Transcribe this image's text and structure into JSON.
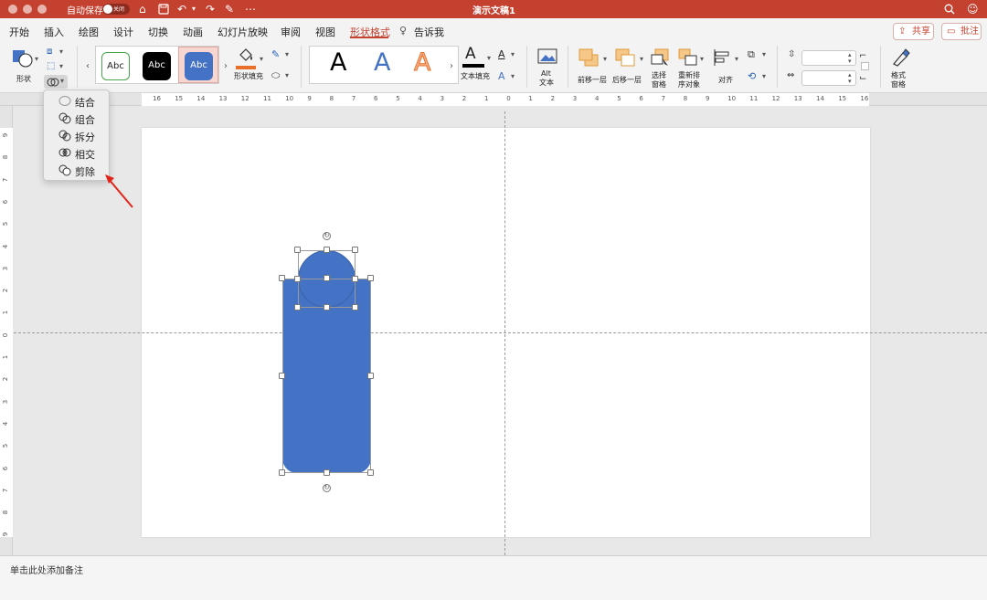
{
  "titlebar": {
    "autosave_label": "自动保存",
    "autosave_state": "关闭",
    "title": "演示文稿1",
    "icons": [
      "home-icon",
      "save-icon",
      "undo-icon",
      "redo-icon",
      "edit-icon",
      "more-icon",
      "search-icon",
      "account-icon"
    ]
  },
  "tabs": [
    "开始",
    "插入",
    "绘图",
    "设计",
    "切换",
    "动画",
    "幻灯片放映",
    "审阅",
    "视图",
    "形状格式",
    "告诉我"
  ],
  "active_tab": "形状格式",
  "share_label": "共享",
  "comment_label": "批注",
  "ribbon": {
    "shapes_label": "形状",
    "style_thumbs": [
      "Abc",
      "Abc",
      "Abc"
    ],
    "shape_fill_label": "形状填充",
    "wordart_letters": [
      "A",
      "A",
      "A"
    ],
    "text_fill_label": "文本填充",
    "alt_text_label_1": "Alt",
    "alt_text_label_2": "文本",
    "bring_forward": "前移一层",
    "send_backward": "后移一层",
    "selection_pane_1": "选择",
    "selection_pane_2": "窗格",
    "reorder_1": "重新排",
    "reorder_2": "序对象",
    "align": "对齐",
    "format_pane_1": "格式",
    "format_pane_2": "窗格"
  },
  "merge_menu": [
    {
      "label": "结合",
      "enabled": false
    },
    {
      "label": "组合",
      "enabled": true
    },
    {
      "label": "拆分",
      "enabled": true
    },
    {
      "label": "相交",
      "enabled": true
    },
    {
      "label": "剪除",
      "enabled": true
    }
  ],
  "ruler_h_labels": [
    "16",
    "15",
    "14",
    "13",
    "12",
    "11",
    "10",
    "9",
    "8",
    "7",
    "6",
    "5",
    "4",
    "3",
    "2",
    "1",
    "0",
    "1",
    "2",
    "3",
    "4",
    "5",
    "6",
    "7",
    "8",
    "9",
    "10",
    "11",
    "12",
    "13",
    "14",
    "15",
    "16"
  ],
  "ruler_v_labels": [
    "9",
    "8",
    "7",
    "6",
    "5",
    "4",
    "3",
    "2",
    "1",
    "0",
    "1",
    "2",
    "3",
    "4",
    "5",
    "6",
    "7",
    "8",
    "9"
  ],
  "status_note": "单击此处添加备注",
  "colors": {
    "accent": "#c4402f",
    "shape_fill": "#4472c4",
    "annotation_arrow": "#e0261b",
    "fill_bar": "#e8702a"
  }
}
